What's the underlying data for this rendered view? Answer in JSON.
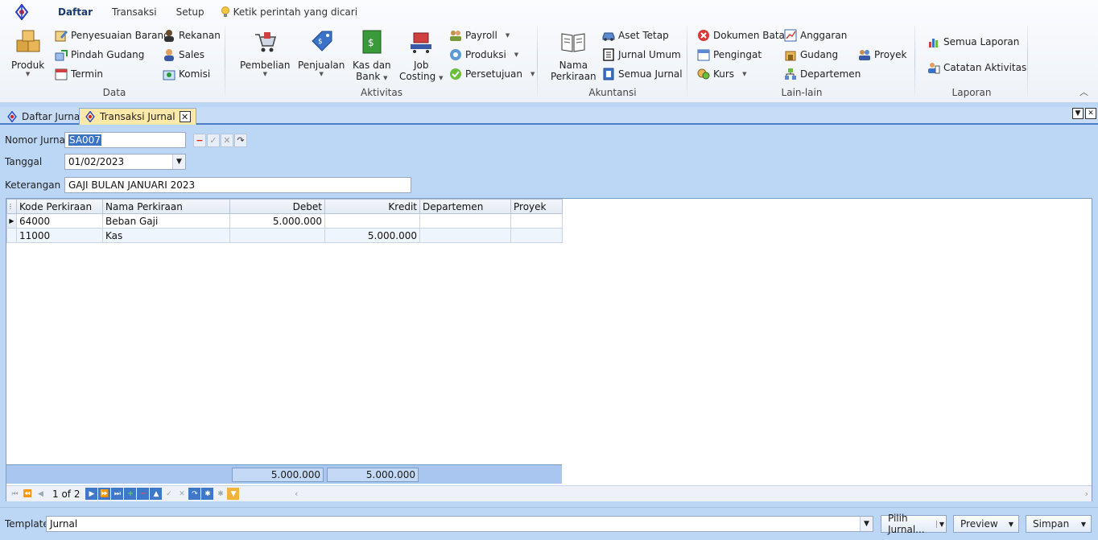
{
  "ribbon": {
    "tabs": [
      "Daftar",
      "Transaksi",
      "Setup"
    ],
    "active_tab": "Daftar",
    "command_search": "Ketik perintah yang dicari",
    "groups": {
      "data": {
        "label": "Data",
        "produk": "Produk",
        "penyesuaian_barang": "Penyesuaian Barang",
        "pindah_gudang": "Pindah Gudang",
        "termin": "Termin",
        "rekanan": "Rekanan",
        "sales": "Sales",
        "komisi": "Komisi"
      },
      "aktivitas": {
        "label": "Aktivitas",
        "pembelian": "Pembelian",
        "penjualan": "Penjualan",
        "kas_dan_bank_1": "Kas dan",
        "kas_dan_bank_2": "Bank",
        "job_costing_1": "Job",
        "job_costing_2": "Costing",
        "payroll": "Payroll",
        "produksi": "Produksi",
        "persetujuan": "Persetujuan"
      },
      "akuntansi": {
        "label": "Akuntansi",
        "nama_perkiraan_1": "Nama",
        "nama_perkiraan_2": "Perkiraan",
        "aset_tetap": "Aset Tetap",
        "jurnal_umum": "Jurnal Umum",
        "semua_jurnal": "Semua Jurnal"
      },
      "lain": {
        "label": "Lain-lain",
        "dokumen_batal": "Dokumen Batal",
        "pengingat": "Pengingat",
        "kurs": "Kurs",
        "anggaran": "Anggaran",
        "gudang": "Gudang",
        "departemen": "Departemen",
        "proyek": "Proyek"
      },
      "laporan": {
        "label": "Laporan",
        "semua_laporan": "Semua Laporan",
        "catatan_aktivitas": "Catatan Aktivitas"
      }
    }
  },
  "doc_tabs": [
    "Daftar Jurnal",
    "Transaksi Jurnal"
  ],
  "form": {
    "nomor_label": "Nomor Jurnal",
    "nomor_value": "SA007",
    "tanggal_label": "Tanggal",
    "tanggal_value": "01/02/2023",
    "keterangan_label": "Keterangan",
    "keterangan_value": "GAJI BULAN JANUARI 2023"
  },
  "grid": {
    "columns": [
      "Kode Perkiraan",
      "Nama Perkiraan",
      "Debet",
      "Kredit",
      "Departemen",
      "Proyek"
    ],
    "rows": [
      {
        "kode": "64000",
        "nama": "Beban Gaji",
        "debet": "5.000.000",
        "kredit": "",
        "dept": "",
        "proyek": ""
      },
      {
        "kode": "11000",
        "nama": "Kas",
        "debet": "",
        "kredit": "5.000.000",
        "dept": "",
        "proyek": ""
      }
    ],
    "total_debet": "5.000.000",
    "total_kredit": "5.000.000",
    "pager": "1 of 2"
  },
  "bottom": {
    "template_label": "Template",
    "template_value": "Jurnal",
    "pilih_jurnal": "Pilih Jurnal...",
    "preview": "Preview",
    "simpan": "Simpan"
  },
  "colors": {
    "accent": "#3f78c8",
    "background": "#bcd6f5",
    "active_tab": "#ffe9a8"
  }
}
